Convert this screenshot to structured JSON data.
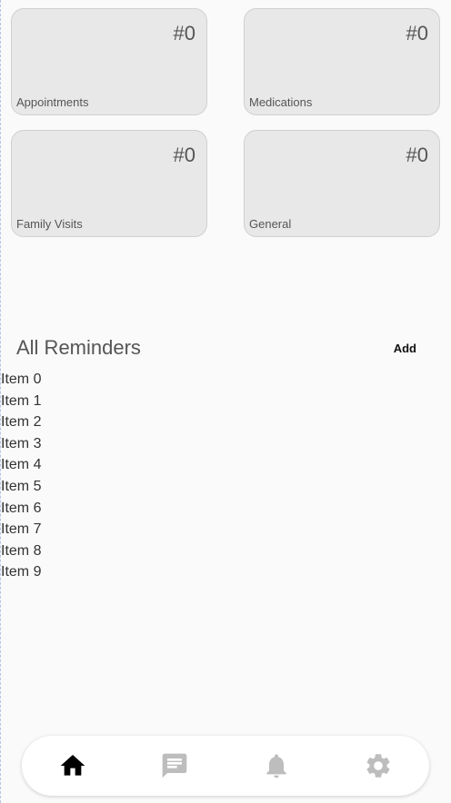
{
  "cards": [
    {
      "count": "#0",
      "label": "Appointments"
    },
    {
      "count": "#0",
      "label": "Medications"
    },
    {
      "count": "#0",
      "label": "Family Visits"
    },
    {
      "count": "#0",
      "label": "General"
    }
  ],
  "reminders": {
    "title": "All Reminders",
    "add_label": "Add",
    "items": [
      "Item 0",
      "Item 1",
      "Item 2",
      "Item 3",
      "Item 4",
      "Item 5",
      "Item 6",
      "Item 7",
      "Item 8",
      "Item 9"
    ]
  },
  "nav": {
    "items": [
      {
        "icon": "home-icon",
        "active": true
      },
      {
        "icon": "chat-icon",
        "active": false
      },
      {
        "icon": "bell-icon",
        "active": false
      },
      {
        "icon": "gear-icon",
        "active": false
      }
    ],
    "active_color": "#000000",
    "inactive_color": "#bdbdbd"
  }
}
